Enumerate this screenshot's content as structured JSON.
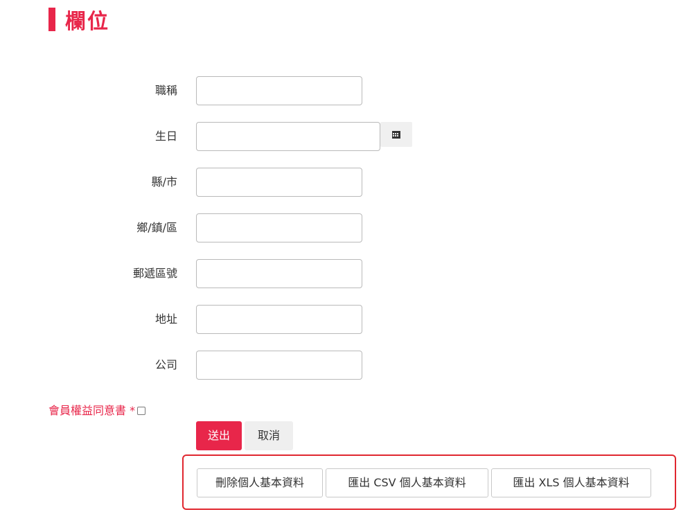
{
  "section": {
    "title": "欄位",
    "accent_color": "#e8264a"
  },
  "fields": [
    {
      "label": "職稱",
      "value": "",
      "placeholder": ""
    },
    {
      "label": "生日",
      "value": "",
      "placeholder": "",
      "icon": "calendar-icon"
    },
    {
      "label": "縣/市",
      "value": "",
      "placeholder": ""
    },
    {
      "label": "鄉/鎮/區",
      "value": "",
      "placeholder": ""
    },
    {
      "label": "郵遞區號",
      "value": "",
      "placeholder": ""
    },
    {
      "label": "地址",
      "value": "",
      "placeholder": ""
    },
    {
      "label": "公司",
      "value": "",
      "placeholder": ""
    }
  ],
  "consent": {
    "label": "會員權益同意書 *",
    "checked": false
  },
  "form_buttons": {
    "submit_label": "送出",
    "cancel_label": "取消"
  },
  "data_actions": {
    "border_color": "#e0272f",
    "delete_label": "刪除個人基本資料",
    "export_csv_label": "匯出 CSV 個人基本資料",
    "export_xls_label": "匯出 XLS 個人基本資料"
  }
}
